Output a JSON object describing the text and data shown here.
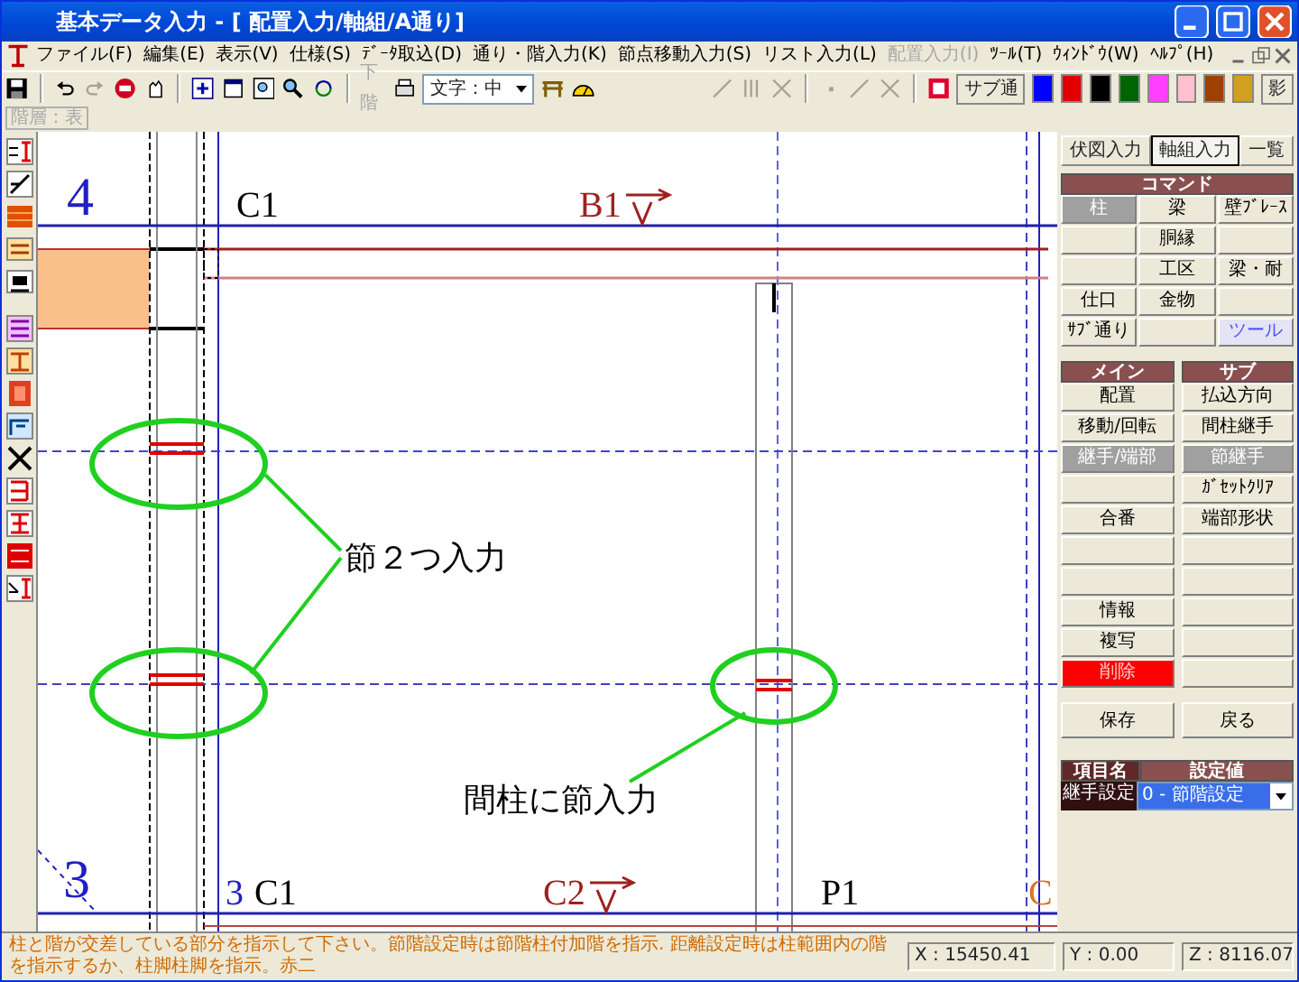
{
  "window": {
    "title": "基本データ入力 - [ 配置入力/軸組/A通り]"
  },
  "menu": [
    {
      "label": "ファイル(F)",
      "disabled": false
    },
    {
      "label": "編集(E)",
      "disabled": false
    },
    {
      "label": "表示(V)",
      "disabled": false
    },
    {
      "label": "仕様(S)",
      "disabled": false
    },
    {
      "label": "ﾃﾞｰﾀ取込(D)",
      "disabled": false
    },
    {
      "label": "通り・階入力(K)",
      "disabled": false
    },
    {
      "label": "節点移動入力(S)",
      "disabled": false
    },
    {
      "label": "リスト入力(L)",
      "disabled": false
    },
    {
      "label": "配置入力(I)",
      "disabled": true
    },
    {
      "label": "ﾂｰﾙ(T)",
      "disabled": false
    },
    {
      "label": "ｳｨﾝﾄﾞｳ(W)",
      "disabled": false
    },
    {
      "label": "ﾍﾙﾌﾟ(H)",
      "disabled": false
    }
  ],
  "toolbar": {
    "tools": [
      {
        "kind": "save",
        "disabled": false
      },
      {
        "kind": "sep"
      },
      {
        "kind": "undo",
        "disabled": false
      },
      {
        "kind": "redo",
        "disabled": true
      },
      {
        "kind": "stop",
        "disabled": false
      },
      {
        "kind": "hand",
        "disabled": false
      },
      {
        "kind": "sep"
      },
      {
        "kind": "fit",
        "disabled": false
      },
      {
        "kind": "frame",
        "disabled": false
      },
      {
        "kind": "zoombox",
        "disabled": false
      },
      {
        "kind": "zoom",
        "disabled": false
      },
      {
        "kind": "redraw",
        "disabled": false
      },
      {
        "kind": "sep"
      }
    ],
    "lower_floor": {
      "label": "下階",
      "disabled": true
    },
    "text_size": "文字：中",
    "tools_right": [
      {
        "kind": "gate",
        "disabled": false
      },
      {
        "kind": "gauge",
        "disabled": false
      },
      {
        "kind": "gap"
      },
      {
        "kind": "line",
        "disabled": true
      },
      {
        "kind": "grid",
        "disabled": true
      },
      {
        "kind": "cross",
        "disabled": true
      },
      {
        "kind": "sep"
      },
      {
        "kind": "dot",
        "disabled": true
      },
      {
        "kind": "line",
        "disabled": true
      },
      {
        "kind": "cross",
        "disabled": true
      },
      {
        "kind": "sep"
      },
      {
        "kind": "record",
        "disabled": false
      }
    ],
    "sub_grid": "サブ通",
    "colors": [
      {
        "color": "#0000ff"
      },
      {
        "color": "#e00000"
      },
      {
        "color": "#000000"
      },
      {
        "color": "#006400"
      },
      {
        "color": "#ff40ff"
      },
      {
        "color": "#ffc0d0"
      },
      {
        "color": "#a04000"
      },
      {
        "color": "#d0a020"
      }
    ],
    "shadow": "影"
  },
  "level_select": {
    "value": "階層：表",
    "disabled": true
  },
  "canvas": {
    "grid_labels": [
      "4",
      "3"
    ],
    "members": [
      {
        "text": "C1",
        "kind": "column"
      },
      {
        "text": "B1",
        "kind": "beam"
      },
      {
        "text": "C1",
        "kind": "column"
      },
      {
        "text": "C2",
        "kind": "beam"
      },
      {
        "text": "P1",
        "kind": "column"
      },
      {
        "text": "C",
        "kind": "edge"
      }
    ],
    "bottom_grid_label": "3",
    "notes": [
      "節２つ入力",
      "間柱に節入力"
    ]
  },
  "panel": {
    "tabs": [
      {
        "label": "伏図入力",
        "selected": false
      },
      {
        "label": "軸組入力",
        "selected": true
      },
      {
        "label": "一覧",
        "selected": false
      }
    ],
    "command_title": "コマンド",
    "commands": [
      {
        "kind": "button",
        "label": "柱",
        "selected": true
      },
      {
        "kind": "button",
        "label": "梁",
        "selected": false
      },
      {
        "kind": "button",
        "label": "壁ﾌﾞﾚｰｽ",
        "selected": false
      },
      {
        "kind": "blank"
      },
      {
        "kind": "button",
        "label": "胴縁",
        "selected": false
      },
      {
        "kind": "blank"
      },
      {
        "kind": "blank"
      },
      {
        "kind": "button",
        "label": "工区",
        "selected": false
      },
      {
        "kind": "button",
        "label": "梁・耐",
        "selected": false
      },
      {
        "kind": "button",
        "label": "仕口",
        "selected": false
      },
      {
        "kind": "button",
        "label": "金物",
        "selected": false
      },
      {
        "kind": "blank"
      },
      {
        "kind": "button",
        "label": "ｻﾌﾞ通り",
        "selected": false
      },
      {
        "kind": "blank"
      },
      {
        "kind": "accent",
        "label": "ツール",
        "selected": false
      }
    ],
    "main_title": "メイン",
    "main": [
      {
        "kind": "button",
        "label": "配置",
        "selected": false
      },
      {
        "kind": "button",
        "label": "移動/回転",
        "selected": false
      },
      {
        "kind": "button",
        "label": "継手/端部",
        "selected": true
      },
      {
        "kind": "blank"
      },
      {
        "kind": "button",
        "label": "合番",
        "selected": false
      },
      {
        "kind": "blank"
      },
      {
        "kind": "blank"
      },
      {
        "kind": "button",
        "label": "情報",
        "selected": false
      },
      {
        "kind": "button",
        "label": "複写",
        "selected": false
      },
      {
        "kind": "danger",
        "label": "削除",
        "selected": false
      }
    ],
    "sub_title": "サブ",
    "sub": [
      {
        "kind": "button",
        "label": "払込方向",
        "selected": false
      },
      {
        "kind": "button",
        "label": "間柱継手",
        "selected": false
      },
      {
        "kind": "button",
        "label": "節継手",
        "selected": true
      },
      {
        "kind": "button",
        "label": "ｶﾞｾｯﾄｸﾘｱ",
        "selected": false
      },
      {
        "kind": "button",
        "label": "端部形状",
        "selected": false
      },
      {
        "kind": "blank"
      },
      {
        "kind": "blank"
      },
      {
        "kind": "blank"
      },
      {
        "kind": "blank"
      },
      {
        "kind": "blank"
      }
    ],
    "save": "保存",
    "back": "戻る",
    "props": {
      "name_header": "項目名",
      "value_header": "設定値",
      "rows": [
        {
          "name": "継手設定",
          "value": "0 - 節階設定"
        }
      ]
    }
  },
  "status_bar": {
    "message": "柱と階が交差している部分を指示して下さい。節階設定時は節階柱付加階を指示. 距離設定時は柱範囲内の階を指示するか、柱脚柱脚を指示。赤二",
    "x": "X : 15450.41",
    "y": "Y : 0.00",
    "z": "Z : 8116.07"
  }
}
